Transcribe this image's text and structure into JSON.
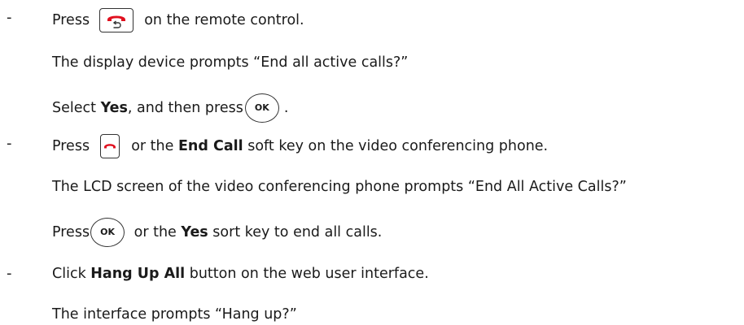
{
  "items": [
    {
      "bullet": "-",
      "line1": {
        "before": "Press",
        "after": "on the remote control."
      },
      "line2": "The display device prompts “End all active calls?”",
      "line3": {
        "t1": "Select ",
        "bold": "Yes",
        "t2": ", and then press",
        "ok": "OK",
        "t3": "."
      }
    },
    {
      "bullet": "-",
      "line1": {
        "before": "Press",
        "after": "or the ",
        "bold": "End Call",
        "after2": " soft key on the video conferencing phone."
      },
      "line2": "The LCD screen of the video conferencing phone prompts “End All Active Calls?”",
      "line3": {
        "t1": "Press",
        "ok": "OK",
        "t2": " or the ",
        "bold": "Yes",
        "t3": " sort key to end all calls."
      }
    },
    {
      "bullet": "-",
      "line1": {
        "t1": "Click ",
        "bold": "Hang Up All",
        "t2": " button on the web user interface."
      },
      "line2": "The interface prompts “Hang up?”"
    }
  ],
  "icons": {
    "remote_hangup": "remote-hangup-key-icon",
    "phone_end": "end-call-key-icon",
    "ok": "ok-key-icon",
    "accent": "#e0101f"
  }
}
